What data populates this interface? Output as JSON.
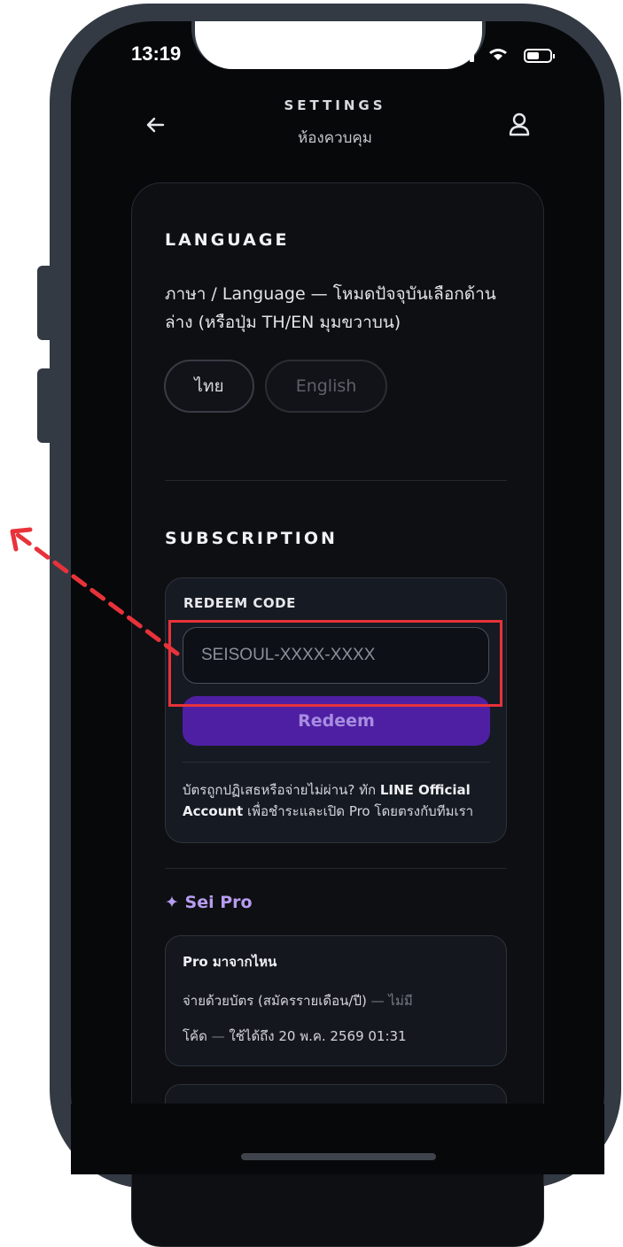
{
  "status_bar": {
    "time": "13:19"
  },
  "header": {
    "title": "SETTINGS",
    "subtitle": "ห้องควบคุม"
  },
  "language": {
    "section_title": "LANGUAGE",
    "description": "ภาษา / Language — โหมดปัจจุบันเลือกด้านล่าง (หรือปุ่ม TH/EN มุมขวาบน)",
    "options": [
      {
        "label": "ไทย",
        "selected": true
      },
      {
        "label": "English",
        "selected": false
      }
    ]
  },
  "subscription": {
    "section_title": "SUBSCRIPTION",
    "redeem_label": "REDEEM CODE",
    "code_placeholder": "SEISOUL-XXXX-XXXX",
    "redeem_button": "Redeem",
    "note_prefix": "บัตรถูกปฏิเสธหรือจ่ายไม่ผ่าน? ทัก ",
    "note_link": "LINE Official Account",
    "note_suffix": " เพื่อชำระและเปิด Pro โดยตรงกับทีมเรา"
  },
  "sei_pro": {
    "title": "✦ Sei Pro",
    "box_title": "Pro มาจากไหน",
    "line1_main": "จ่ายด้วยบัตร (สมัครรายเดือน/ปี)",
    "line1_muted": " — ไม่มี",
    "line2_main": "โค้ด",
    "line2_muted": " — ",
    "line2_tail": "ใช้ได้ถึง 20 พ.ค. 2569 01:31"
  },
  "colors": {
    "accent": "#4f1fa3",
    "highlight": "#e8323a",
    "pro": "#b69cf0",
    "frame": "#343a44"
  }
}
